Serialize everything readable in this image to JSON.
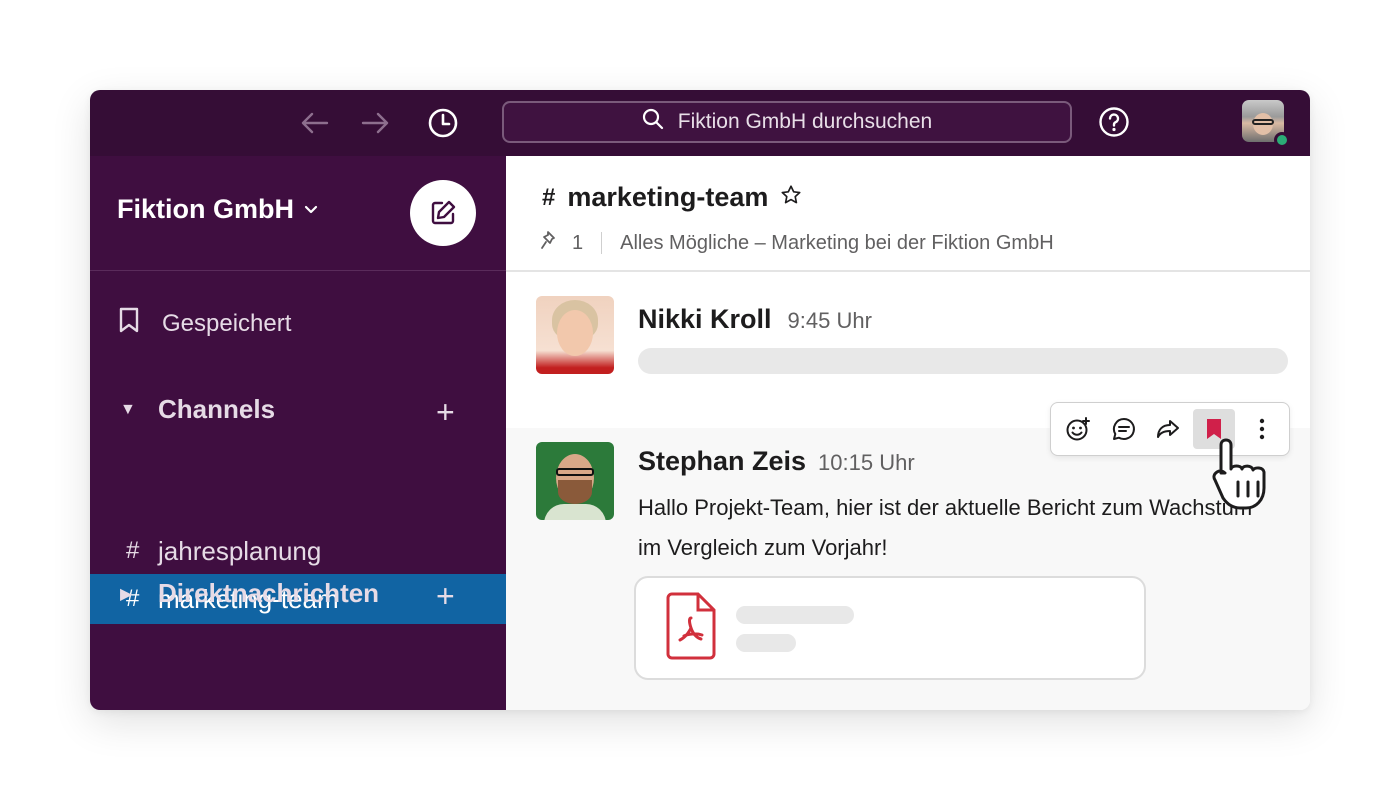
{
  "topbar": {
    "search_placeholder": "Fiktion GmbH durchsuchen",
    "back_icon": "arrow-left-icon",
    "forward_icon": "arrow-right-icon",
    "history_icon": "clock-icon",
    "help_icon": "question-circle-icon",
    "presence": "online"
  },
  "sidebar": {
    "workspace_name": "Fiktion GmbH",
    "saved_label": "Gespeichert",
    "channels_header": "Channels",
    "channels": [
      {
        "hash": "#",
        "name": "jahresplanung",
        "active": false
      },
      {
        "hash": "#",
        "name": "marketing-team",
        "active": true
      }
    ],
    "dms_header": "Direktnachrichten"
  },
  "channel": {
    "hash": "#",
    "name": "marketing-team",
    "pin_count": "1",
    "description": "Alles Mögliche – Marketing bei der Fiktion GmbH"
  },
  "messages": [
    {
      "author": "Nikki Kroll",
      "time": "9:45 Uhr"
    },
    {
      "author": "Stephan Zeis",
      "time": "10:15 Uhr",
      "text": "Hallo Projekt-Team, hier ist der aktuelle Bericht zum Wachstum im Vergleich zum Vorjahr!",
      "attachment_icon": "pdf-file-icon"
    }
  ],
  "message_actions": [
    "add-reaction-icon",
    "reply-thread-icon",
    "share-icon",
    "bookmark-icon",
    "more-vertical-icon"
  ],
  "colors": {
    "topbar_bg": "#350d36",
    "sidebar_bg": "#3f0e40",
    "active_channel": "#1164a3",
    "saved_accent": "#d0204a",
    "pdf_red": "#d1303c",
    "presence_green": "#2bac76"
  }
}
